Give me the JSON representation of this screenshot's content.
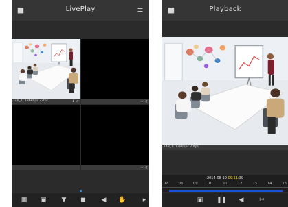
{
  "liveplay": {
    "title": "LivePlay",
    "channel_status": "148_1: 136kbps 22fps",
    "status_icons": "↓ ◁"
  },
  "playback": {
    "title": "Playback",
    "channel_status": "148_1: 128kbps 20fps",
    "timeline": {
      "date_prefix": "2014-08-19 ",
      "time_highlight": "09:11",
      "time_suffix": ":39",
      "hours": [
        "07",
        "08",
        "09",
        "10",
        "11",
        "12",
        "13",
        "14",
        "15"
      ]
    }
  },
  "colors": {
    "background": "#2b2b2b",
    "appbar": "#353535",
    "timeline_bar": "#1a54d8",
    "time_highlight": "#ffd400",
    "page_dot": "#3fa9f5"
  }
}
